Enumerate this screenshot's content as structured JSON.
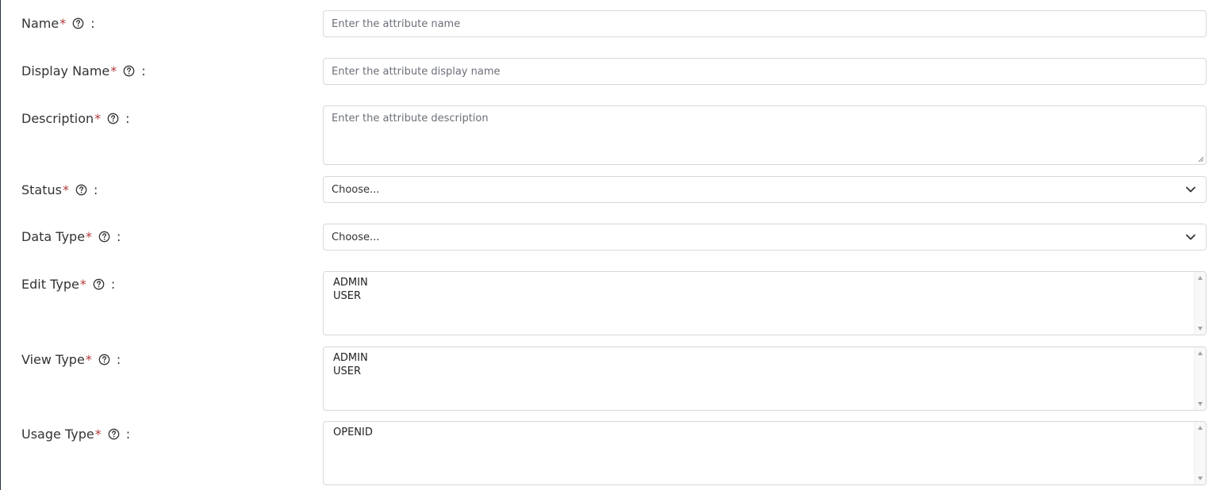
{
  "form": {
    "name": {
      "label": "Name",
      "required_mark": "*",
      "colon": ":",
      "placeholder": "Enter the attribute name",
      "help_icon": "question-circle-icon"
    },
    "display_name": {
      "label": "Display Name",
      "required_mark": "*",
      "colon": ":",
      "placeholder": "Enter the attribute display name",
      "help_icon": "question-circle-icon"
    },
    "description": {
      "label": "Description",
      "required_mark": "*",
      "colon": ":",
      "placeholder": "Enter the attribute description",
      "help_icon": "question-circle-icon"
    },
    "status": {
      "label": "Status",
      "required_mark": "*",
      "colon": ":",
      "selected": "Choose...",
      "help_icon": "question-circle-icon"
    },
    "data_type": {
      "label": "Data Type",
      "required_mark": "*",
      "colon": ":",
      "selected": "Choose...",
      "help_icon": "question-circle-icon"
    },
    "edit_type": {
      "label": "Edit Type",
      "required_mark": "*",
      "colon": ":",
      "options": [
        "ADMIN",
        "USER"
      ],
      "help_icon": "question-circle-icon"
    },
    "view_type": {
      "label": "View Type",
      "required_mark": "*",
      "colon": ":",
      "options": [
        "ADMIN",
        "USER"
      ],
      "help_icon": "question-circle-icon"
    },
    "usage_type": {
      "label": "Usage Type",
      "required_mark": "*",
      "colon": ":",
      "options": [
        "OPENID"
      ],
      "help_icon": "question-circle-icon"
    }
  },
  "colors": {
    "required": "#b33a3a",
    "text": "#333333",
    "border": "#d5d8dc",
    "placeholder": "#6b7077"
  }
}
